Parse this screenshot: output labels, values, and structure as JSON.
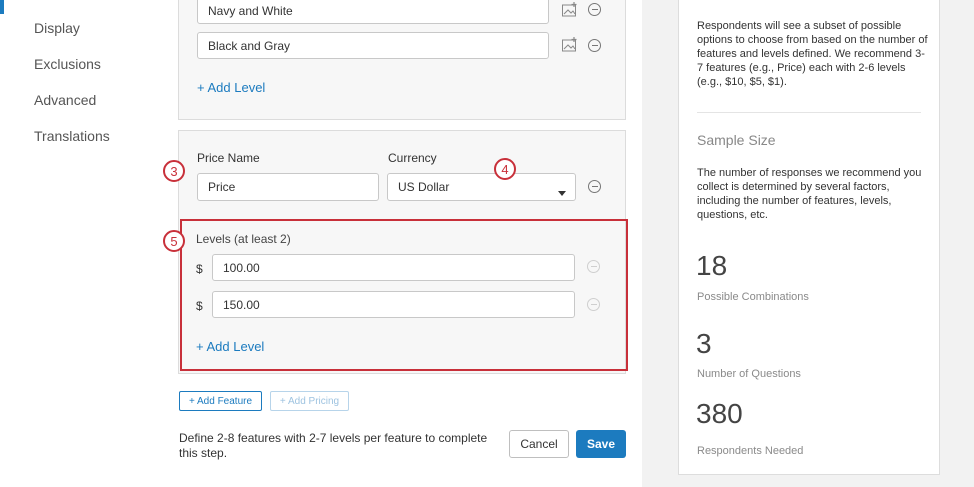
{
  "nav": {
    "items": [
      "Display",
      "Exclusions",
      "Advanced",
      "Translations"
    ]
  },
  "feature_card": {
    "levels": [
      "Navy and White",
      "Black and Gray"
    ],
    "add_level": "+ Add Level"
  },
  "price_card": {
    "price_name_label": "Price Name",
    "price_name_value": "Price",
    "currency_label": "Currency",
    "currency_value": "US Dollar",
    "levels_label": "Levels (at least 2)",
    "currency_symbol": "$",
    "levels": [
      "100.00",
      "150.00"
    ],
    "add_level": "+ Add Level"
  },
  "callouts": [
    "3",
    "4",
    "5"
  ],
  "bottom": {
    "add_feature": "+ Add Feature",
    "add_pricing": "+ Add Pricing",
    "hint": "Define 2-8 features with 2-7 levels per feature to complete this step.",
    "cancel": "Cancel",
    "save": "Save"
  },
  "right_panel": {
    "features_text": "Respondents will see a subset of possible options to choose from based on the number of features and levels defined. We recommend 3-7 features (e.g., Price) each with 2-6 levels (e.g., $10, $5, $1).",
    "sample_size_title": "Sample Size",
    "sample_size_text": "The number of responses we recommend you collect is determined by several factors, including the number of features, levels, questions, etc.",
    "stats": [
      {
        "value": "18",
        "label": "Possible Combinations"
      },
      {
        "value": "3",
        "label": "Number of Questions"
      },
      {
        "value": "380",
        "label": "Respondents Needed"
      }
    ]
  },
  "colors": {
    "accent": "#1c7bbf",
    "callout_red": "#c8303a"
  }
}
